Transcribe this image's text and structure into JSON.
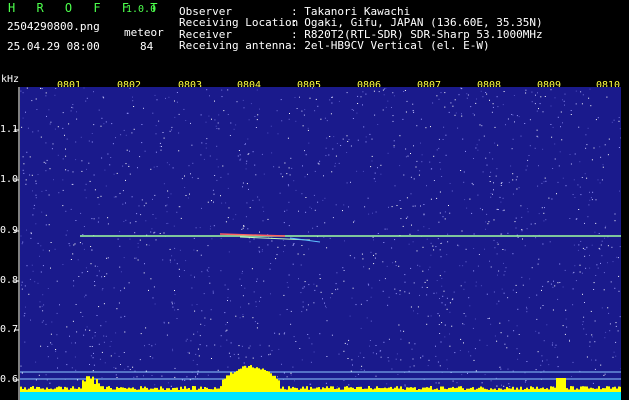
{
  "header": {
    "brand": "H R O F F T",
    "version": "1.0.0",
    "filename": "2504290800.png",
    "meteor_label": "meteor",
    "datetime": "25.04.29 08:00",
    "meteor_count": "84",
    "fields": [
      {
        "label": "Observer",
        "value": ": Takanori Kawachi"
      },
      {
        "label": "Receiving Location",
        "value": ": Ogaki, Gifu, JAPAN (136.60E, 35.35N)"
      },
      {
        "label": "Receiver",
        "value": ": R820T2(RTL-SDR) SDR-Sharp 53.1000MHz"
      },
      {
        "label": "Receiving antenna",
        "value": ": 2el-HB9CV Vertical (el. E-W)"
      }
    ]
  },
  "axis": {
    "unit": "kHz",
    "y_ticks": [
      "1.1",
      "1.0",
      "0.9",
      "0.8",
      "0.7",
      "0.6"
    ],
    "x_ticks": [
      "0801",
      "0802",
      "0803",
      "0804",
      "0805",
      "0806",
      "0807",
      "0808",
      "0809",
      "0810"
    ]
  },
  "colors": {
    "plot_background": "#1a1a8c",
    "signal": "#a0ffa0",
    "histogram": "#ffff00",
    "histogram_base": "#00e5ff"
  }
}
